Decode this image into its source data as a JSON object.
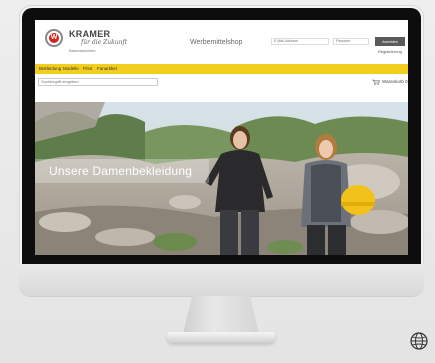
{
  "header": {
    "brand_name": "KRAMER",
    "brand_tagline": "für die Zukunft",
    "brand_sub": "Baumaschinen",
    "logo_letter": "W",
    "shop_title": "Werbemittelshop",
    "email_placeholder": "E-Mail-Adresse",
    "password_placeholder": "Passwort",
    "login_label": "Anmelden",
    "register_label": "Registrierung"
  },
  "nav": {
    "items": [
      {
        "label": "Bekleidung"
      },
      {
        "label": "Modelle"
      },
      {
        "label": "Print"
      },
      {
        "label": "Fanartikel"
      }
    ]
  },
  "search": {
    "placeholder": "Suchbegriff eingeben",
    "cart_label": "Warenkorb 0"
  },
  "hero": {
    "caption": "Unsere Damenbekleidung"
  },
  "colors": {
    "nav_yellow": "#f2cf1e",
    "logo_red": "#d6231e",
    "bezel": "#0d0d0d",
    "button_gray": "#5a5a5a"
  },
  "icons": {
    "globe": "globe-icon",
    "cart": "cart-icon"
  }
}
